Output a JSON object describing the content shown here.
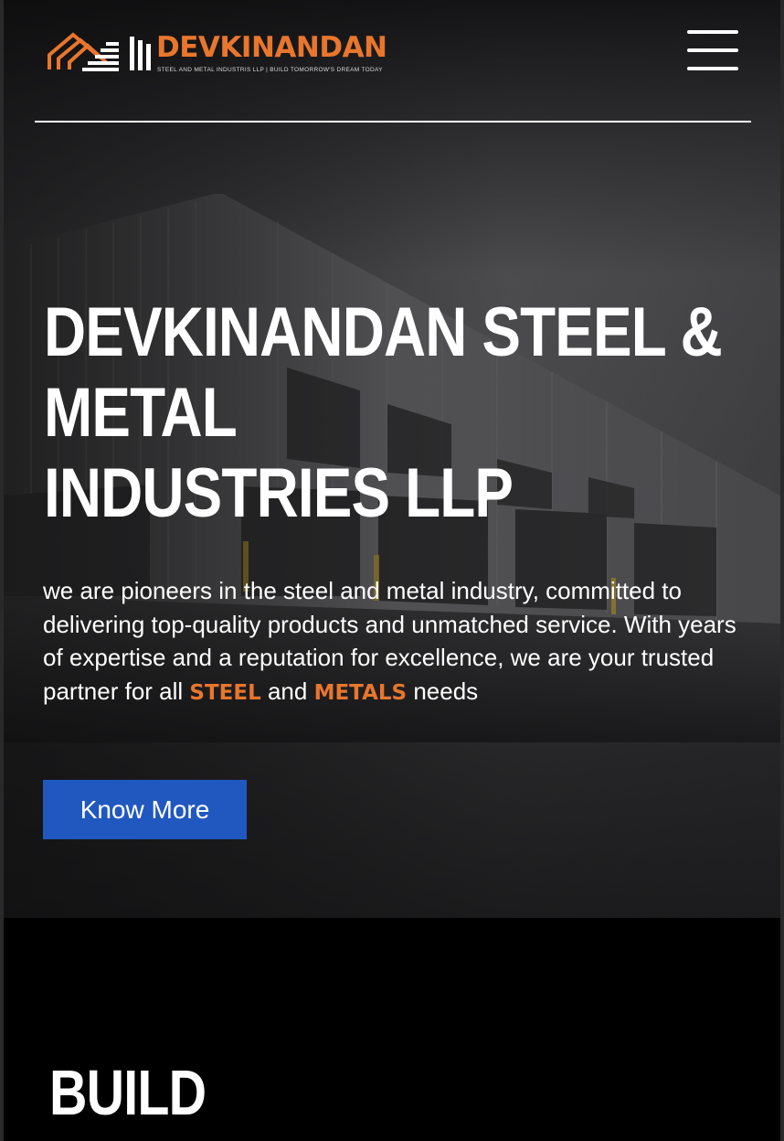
{
  "header": {
    "logo": {
      "name": "DEVKINANDAN",
      "tagline": "STEEL AND METAL INDUSTRIS LLP | BUILD TOMORROW'S DREAM TODAY",
      "icon": "warehouse-roof-logo-icon",
      "color": "#e8762d"
    },
    "menu_icon": "hamburger-menu-icon"
  },
  "hero": {
    "title_lines": [
      "DEVKINANDAN STEEL &",
      "METAL",
      "INDUSTRIES LLP"
    ],
    "description": {
      "text_before": "we are pioneers in the steel and metal industry, committed to delivering top-quality products and unmatched service. With years of expertise and a reputation for excellence, we are your trusted partner for all ",
      "highlight_1": "STEEL",
      "middle": " and ",
      "highlight_2": "METALS",
      "text_after": " needs"
    },
    "cta_label": "Know More",
    "accent": "#e8762d",
    "button_color": "#2158c0"
  },
  "next_section": {
    "title": "BUILD"
  }
}
